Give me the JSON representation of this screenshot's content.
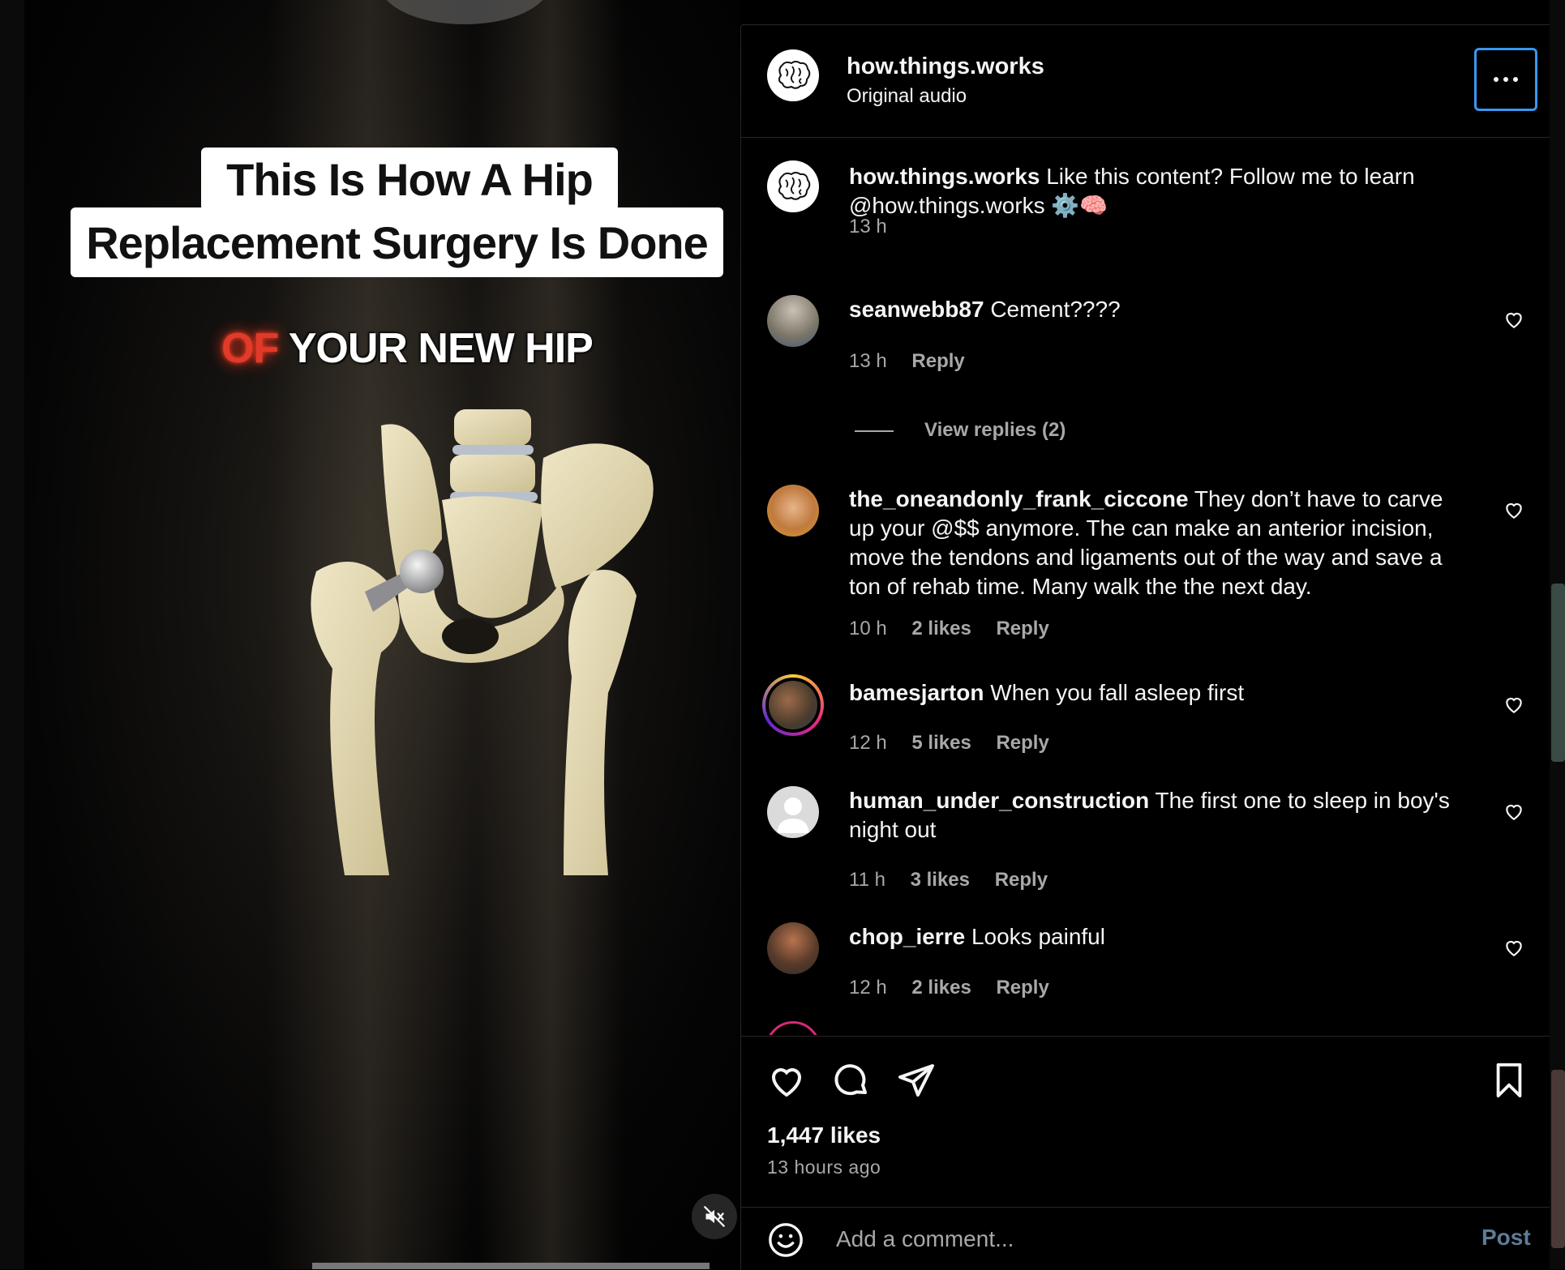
{
  "video": {
    "title_line1": "This Is How A Hip",
    "title_line2": "Replacement Surgery Is Done",
    "caption_red": "OF",
    "caption_white": "YOUR NEW HIP",
    "mute_icon": "speaker-muted-icon"
  },
  "header": {
    "username": "how.things.works",
    "audio": "Original audio",
    "more_icon": "ellipsis-icon"
  },
  "caption_comment": {
    "username": "how.things.works",
    "text": "Like this content? Follow me to learn @how.things.works ⚙️🧠",
    "time": "13 h"
  },
  "comments": [
    {
      "username": "seanwebb87",
      "text": "Cement????",
      "time": "13 h",
      "likes": "",
      "reply": "Reply"
    },
    {
      "username": "the_oneandonly_frank_ciccone",
      "text": "They don’t have to carve up your @$$ anymore. The can make an anterior incision, move the tendons and ligaments out of the way and save a ton of rehab time. Many walk the the next day.",
      "time": "10 h",
      "likes": "2 likes",
      "reply": "Reply"
    },
    {
      "username": "bamesjarton",
      "text": "When you fall asleep first",
      "time": "12 h",
      "likes": "5 likes",
      "reply": "Reply"
    },
    {
      "username": "human_under_construction",
      "text": "The first one to sleep in boy's night out",
      "time": "11 h",
      "likes": "3 likes",
      "reply": "Reply"
    },
    {
      "username": "chop_ierre",
      "text": "Looks painful",
      "time": "12 h",
      "likes": "2 likes",
      "reply": "Reply"
    }
  ],
  "view_replies": "View replies (2)",
  "actions": {
    "likes": "1,447 likes",
    "time_ago": "13 hours ago",
    "icons": [
      "heart-icon",
      "comment-icon",
      "share-icon",
      "bookmark-icon"
    ]
  },
  "composer": {
    "placeholder": "Add a comment...",
    "post_label": "Post",
    "emoji_icon": "emoji-icon"
  },
  "colors": {
    "accent": "#3897f0",
    "post_disabled": "#5d7c97",
    "muted_text": "#a8a8a8",
    "divider": "#262626"
  }
}
